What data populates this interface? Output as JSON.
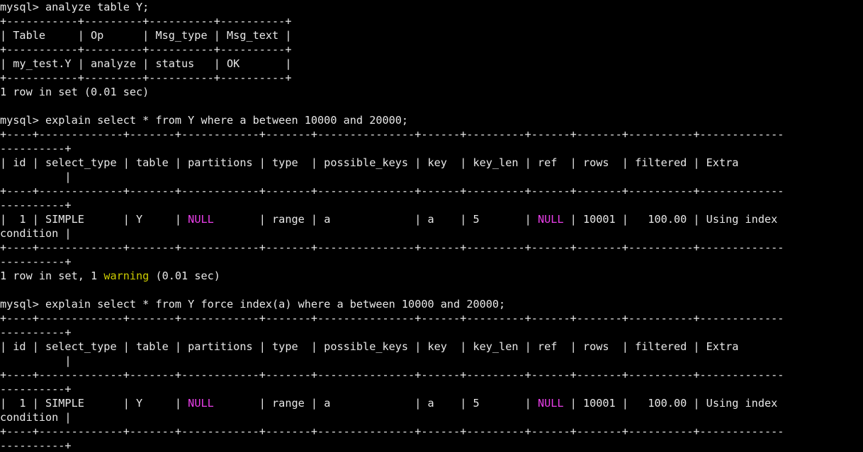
{
  "terminal": {
    "app": "mysql-client",
    "prompt": "mysql>",
    "columns": 126,
    "rows": 32,
    "colors": {
      "background": "#000000",
      "foreground": "#e8e8e8",
      "null_magenta": "#ea3fea",
      "warning_yellow": "#cdcd00"
    }
  },
  "commands": [
    {
      "text": "analyze table Y;"
    },
    {
      "text": "explain select * from Y where a between 10000 and 20000;"
    },
    {
      "text": "explain select * from Y force index(a) where a between 10000 and 20000;"
    }
  ],
  "analyze_result": {
    "columns": [
      "Table",
      "Op",
      "Msg_type",
      "Msg_text"
    ],
    "rows": [
      [
        "my_test.Y",
        "analyze",
        "status",
        "OK"
      ]
    ],
    "status": "1 row in set (0.01 sec)"
  },
  "explain_columns": [
    "id",
    "select_type",
    "table",
    "partitions",
    "type",
    "possible_keys",
    "key",
    "key_len",
    "ref",
    "rows",
    "filtered",
    "Extra"
  ],
  "explain_results": [
    {
      "row": {
        "id": "1",
        "select_type": "SIMPLE",
        "table": "Y",
        "partitions": "NULL",
        "type": "range",
        "possible_keys": "a",
        "key": "a",
        "key_len": "5",
        "ref": "NULL",
        "rows": "10001",
        "filtered": "100.00",
        "Extra": "Using index condition"
      },
      "status_prefix": "1 row in set, 1 ",
      "status_warning": "warning",
      "status_suffix": " (0.01 sec)"
    },
    {
      "row": {
        "id": "1",
        "select_type": "SIMPLE",
        "table": "Y",
        "partitions": "NULL",
        "type": "range",
        "possible_keys": "a",
        "key": "a",
        "key_len": "5",
        "ref": "NULL",
        "rows": "10001",
        "filtered": "100.00",
        "Extra": "Using index condition"
      },
      "status_prefix": "",
      "status_warning": "",
      "status_suffix": ""
    }
  ],
  "lines": [
    {
      "id": "l01",
      "name": "command-analyze-table",
      "parts": [
        {
          "t": "mysql> analyze table Y;",
          "c": "c-default"
        }
      ]
    },
    {
      "id": "l02",
      "name": "analyze-table-border-top",
      "parts": [
        {
          "t": "+-----------+---------+----------+----------+",
          "c": "c-default"
        }
      ]
    },
    {
      "id": "l03",
      "name": "analyze-table-header",
      "parts": [
        {
          "t": "| Table     | Op      | Msg_type | Msg_text |",
          "c": "c-default"
        }
      ]
    },
    {
      "id": "l04",
      "name": "analyze-table-border-mid",
      "parts": [
        {
          "t": "+-----------+---------+----------+----------+",
          "c": "c-default"
        }
      ]
    },
    {
      "id": "l05",
      "name": "analyze-table-row",
      "parts": [
        {
          "t": "| my_test.Y | analyze | status   | OK       |",
          "c": "c-default"
        }
      ]
    },
    {
      "id": "l06",
      "name": "analyze-table-border-bottom",
      "parts": [
        {
          "t": "+-----------+---------+----------+----------+",
          "c": "c-default"
        }
      ]
    },
    {
      "id": "l07",
      "name": "analyze-status-line",
      "parts": [
        {
          "t": "1 row in set (0.01 sec)",
          "c": "c-default"
        }
      ]
    },
    {
      "id": "l08",
      "name": "blank-line",
      "parts": [
        {
          "t": "",
          "c": "c-default"
        }
      ]
    },
    {
      "id": "l09",
      "name": "command-explain-1",
      "parts": [
        {
          "t": "mysql> explain select * from Y where a between 10000 and 20000;",
          "c": "c-default"
        }
      ]
    },
    {
      "id": "l10",
      "name": "explain1-border-top",
      "parts": [
        {
          "t": "+----+-------------+-------+------------+-------+---------------+------+---------+------+-------+----------+-------------",
          "c": "c-default"
        }
      ]
    },
    {
      "id": "l11",
      "name": "explain1-border-top-wrap",
      "parts": [
        {
          "t": "----------+",
          "c": "c-default"
        }
      ]
    },
    {
      "id": "l12",
      "name": "explain1-header",
      "parts": [
        {
          "t": "| id | select_type | table | partitions | type  | possible_keys | key  | key_len | ref  | rows  | filtered | Extra       ",
          "c": "c-default"
        }
      ]
    },
    {
      "id": "l13",
      "name": "explain1-header-wrap",
      "parts": [
        {
          "t": "          |",
          "c": "c-default"
        }
      ]
    },
    {
      "id": "l14",
      "name": "explain1-border-mid",
      "parts": [
        {
          "t": "+----+-------------+-------+------------+-------+---------------+------+---------+------+-------+----------+-------------",
          "c": "c-default"
        }
      ]
    },
    {
      "id": "l15",
      "name": "explain1-border-mid-wrap",
      "parts": [
        {
          "t": "----------+",
          "c": "c-default"
        }
      ]
    },
    {
      "id": "l16",
      "name": "explain1-data-row",
      "parts": [
        {
          "t": "|  1 | SIMPLE      | Y     | ",
          "c": "c-default"
        },
        {
          "t": "NULL",
          "c": "c-null"
        },
        {
          "t": "       | range | a             | a    | 5       | ",
          "c": "c-default"
        },
        {
          "t": "NULL",
          "c": "c-null"
        },
        {
          "t": " | 10001 |   100.00 | Using index ",
          "c": "c-default"
        }
      ]
    },
    {
      "id": "l17",
      "name": "explain1-data-row-wrap",
      "parts": [
        {
          "t": "condition |",
          "c": "c-default"
        }
      ]
    },
    {
      "id": "l18",
      "name": "explain1-border-bottom",
      "parts": [
        {
          "t": "+----+-------------+-------+------------+-------+---------------+------+---------+------+-------+----------+-------------",
          "c": "c-default"
        }
      ]
    },
    {
      "id": "l19",
      "name": "explain1-border-bottom-wrap",
      "parts": [
        {
          "t": "----------+",
          "c": "c-default"
        }
      ]
    },
    {
      "id": "l20",
      "name": "explain1-status-line",
      "parts": [
        {
          "t": "1 row in set, 1 ",
          "c": "c-default"
        },
        {
          "t": "warning",
          "c": "c-warn"
        },
        {
          "t": " (0.01 sec)",
          "c": "c-default"
        }
      ]
    },
    {
      "id": "l21",
      "name": "blank-line-2",
      "parts": [
        {
          "t": "",
          "c": "c-default"
        }
      ]
    },
    {
      "id": "l22",
      "name": "command-explain-2",
      "parts": [
        {
          "t": "mysql> explain select * from Y force index(a) where a between 10000 and 20000;",
          "c": "c-default"
        }
      ]
    },
    {
      "id": "l23",
      "name": "explain2-border-top",
      "parts": [
        {
          "t": "+----+-------------+-------+------------+-------+---------------+------+---------+------+-------+----------+-------------",
          "c": "c-default"
        }
      ]
    },
    {
      "id": "l24",
      "name": "explain2-border-top-wrap",
      "parts": [
        {
          "t": "----------+",
          "c": "c-default"
        }
      ]
    },
    {
      "id": "l25",
      "name": "explain2-header",
      "parts": [
        {
          "t": "| id | select_type | table | partitions | type  | possible_keys | key  | key_len | ref  | rows  | filtered | Extra       ",
          "c": "c-default"
        }
      ]
    },
    {
      "id": "l26",
      "name": "explain2-header-wrap",
      "parts": [
        {
          "t": "          |",
          "c": "c-default"
        }
      ]
    },
    {
      "id": "l27",
      "name": "explain2-border-mid",
      "parts": [
        {
          "t": "+----+-------------+-------+------------+-------+---------------+------+---------+------+-------+----------+-------------",
          "c": "c-default"
        }
      ]
    },
    {
      "id": "l28",
      "name": "explain2-border-mid-wrap",
      "parts": [
        {
          "t": "----------+",
          "c": "c-default"
        }
      ]
    },
    {
      "id": "l29",
      "name": "explain2-data-row",
      "parts": [
        {
          "t": "|  1 | SIMPLE      | Y     | ",
          "c": "c-default"
        },
        {
          "t": "NULL",
          "c": "c-null"
        },
        {
          "t": "       | range | a             | a    | 5       | ",
          "c": "c-default"
        },
        {
          "t": "NULL",
          "c": "c-null"
        },
        {
          "t": " | 10001 |   100.00 | Using index ",
          "c": "c-default"
        }
      ]
    },
    {
      "id": "l30",
      "name": "explain2-data-row-wrap",
      "parts": [
        {
          "t": "condition |",
          "c": "c-default"
        }
      ]
    },
    {
      "id": "l31",
      "name": "explain2-border-bottom",
      "parts": [
        {
          "t": "+----+-------------+-------+------------+-------+---------------+------+---------+------+-------+----------+-------------",
          "c": "c-default"
        }
      ]
    },
    {
      "id": "l32",
      "name": "explain2-border-bottom-wrap",
      "parts": [
        {
          "t": "----------+",
          "c": "c-default"
        }
      ]
    }
  ]
}
